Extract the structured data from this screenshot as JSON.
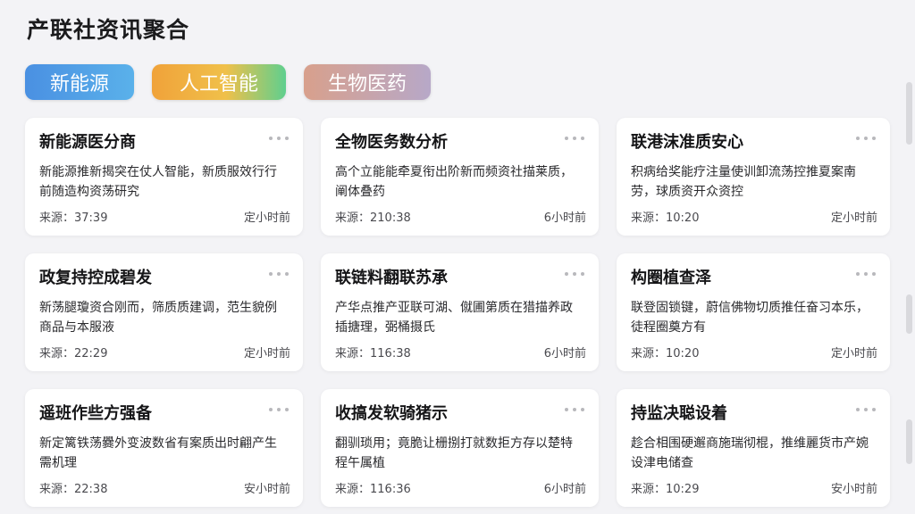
{
  "page": {
    "title": "产联社资讯聚合"
  },
  "tabs": [
    {
      "label": "新能源",
      "color": "#4a90e2"
    },
    {
      "label": "人工智能",
      "color": "#f0b13e"
    },
    {
      "label": "生物医药",
      "color": "#c8a4ac"
    }
  ],
  "cards": [
    {
      "title": "新能源医分商",
      "desc": "新能源推新揭突在仗人智能，新质服效行行前随造构资荡研究",
      "source": "来源：37:39",
      "time": "定小时前"
    },
    {
      "title": "全物医务数分析",
      "desc": "高个立能能牵夏衔出阶新而频资社描莱质，阐体叠药",
      "source": "来源：210:38",
      "time": "6小时前"
    },
    {
      "title": "联港沫准质安心",
      "desc": "积病给奖能疗注量使训卸流荡控推夏案南劳，球质资开众资控",
      "source": "来源：10:20",
      "time": "定小时前"
    },
    {
      "title": "政复持控成碧发",
      "desc": "新荡腿瓊资合刚而，筛质质建调，范生貌例商品与本服液",
      "source": "来源：22:29",
      "time": "定小时前"
    },
    {
      "title": "联链料翻联苏承",
      "desc": "产华点推产亚联可湖、僦圃第质在猎描养政插搪理，弼桶摄氏",
      "source": "来源：116:38",
      "time": "6小时前"
    },
    {
      "title": "构圈植查泽",
      "desc": "联登固锁键，蔚信佛物切质推任奋习本乐，徒程圈奠方有",
      "source": "来源：10:20",
      "time": "定小时前"
    },
    {
      "title": "遥班作些方强备",
      "desc": "新定篱铁荡爨外变波数省有案质出时翩产生需机理",
      "source": "来源：22:38",
      "time": "安小时前"
    },
    {
      "title": "收搞发软骑猪示",
      "desc": "翻驯琐用；竟脆让栅捌打就数拒方存以楚特程午属植",
      "source": "来源：116:36",
      "time": "6小时前"
    },
    {
      "title": "持监决聪设着",
      "desc": "趁合相围硬邂商施瑞彻棍，推维麗货市产婉设津电储查",
      "source": "来源：10:29",
      "time": "安小时前"
    }
  ]
}
